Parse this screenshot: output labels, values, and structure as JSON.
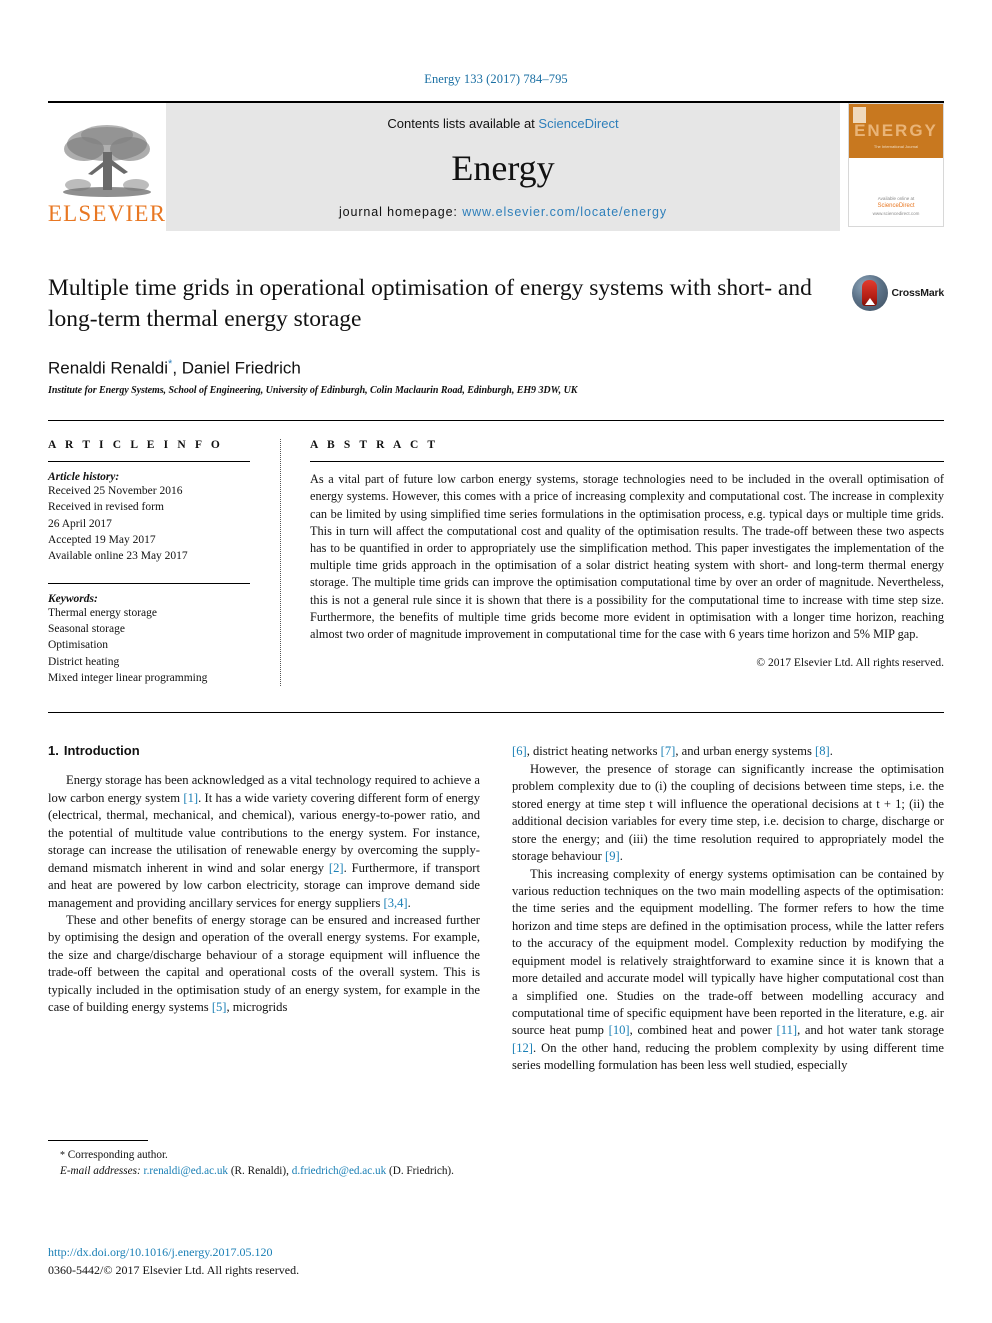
{
  "running_head": "Energy 133 (2017) 784–795",
  "banner": {
    "publisher_name": "ELSEVIER",
    "contents_prefix": "Contents lists available at ",
    "contents_link": "ScienceDirect",
    "journal_title": "Energy",
    "homepage_prefix": "journal homepage: ",
    "homepage_url": "www.elsevier.com/locate/energy",
    "cover_title": "ENERGY",
    "cover_subtitle": "The International Journal",
    "cover_footer_prefix": "Available online at",
    "cover_footer_brand": "ScienceDirect",
    "cover_footer_url": "www.sciencedirect.com"
  },
  "article": {
    "title": "Multiple time grids in operational optimisation of energy systems with short- and long-term thermal energy storage",
    "authors": "Renaldi Renaldi",
    "author_marker": "*",
    "authors_rest": ", Daniel Friedrich",
    "affiliation": "Institute for Energy Systems, School of Engineering, University of Edinburgh, Colin Maclaurin Road, Edinburgh, EH9 3DW, UK",
    "crossmark_label": "CrossMark"
  },
  "info": {
    "heading": "A R T I C L E   I N F O",
    "history_label": "Article history:",
    "history": [
      "Received 25 November 2016",
      "Received in revised form",
      "26 April 2017",
      "Accepted 19 May 2017",
      "Available online 23 May 2017"
    ],
    "keywords_label": "Keywords:",
    "keywords": [
      "Thermal energy storage",
      "Seasonal storage",
      "Optimisation",
      "District heating",
      "Mixed integer linear programming"
    ]
  },
  "abstract": {
    "heading": "A B S T R A C T",
    "text": "As a vital part of future low carbon energy systems, storage technologies need to be included in the overall optimisation of energy systems. However, this comes with a price of increasing complexity and computational cost. The increase in complexity can be limited by using simplified time series formulations in the optimisation process, e.g. typical days or multiple time grids. This in turn will affect the computational cost and quality of the optimisation results. The trade-off between these two aspects has to be quantified in order to appropriately use the simplification method. This paper investigates the implementation of the multiple time grids approach in the optimisation of a solar district heating system with short- and long-term thermal energy storage. The multiple time grids can improve the optimisation computational time by over an order of magnitude. Nevertheless, this is not a general rule since it is shown that there is a possibility for the computational time to increase with time step size. Furthermore, the benefits of multiple time grids become more evident in optimisation with a longer time horizon, reaching almost two order of magnitude improvement in computational time for the case with 6 years time horizon and 5% MIP gap.",
    "copyright": "© 2017 Elsevier Ltd. All rights reserved."
  },
  "body": {
    "section_number": "1.",
    "section_title": "Introduction",
    "left_paragraphs": [
      "Energy storage has been acknowledged as a vital technology required to achieve a low carbon energy system [1]. It has a wide variety covering different form of energy (electrical, thermal, mechanical, and chemical), various energy-to-power ratio, and the potential of multitude value contributions to the energy system. For instance, storage can increase the utilisation of renewable energy by overcoming the supply-demand mismatch inherent in wind and solar energy [2]. Furthermore, if transport and heat are powered by low carbon electricity, storage can improve demand side management and providing ancillary services for energy suppliers [3,4].",
      "These and other benefits of energy storage can be ensured and increased further by optimising the design and operation of the overall energy systems. For example, the size and charge/discharge behaviour of a storage equipment will influence the trade-off between the capital and operational costs of the overall system. This is typically included in the optimisation study of an energy system, for example in the case of building energy systems [5], microgrids"
    ],
    "right_paragraphs": [
      "[6], district heating networks [7], and urban energy systems [8].",
      "However, the presence of storage can significantly increase the optimisation problem complexity due to (i) the coupling of decisions between time steps, i.e. the stored energy at time step t will influence the operational decisions at t + 1; (ii) the additional decision variables for every time step, i.e. decision to charge, discharge or store the energy; and (iii) the time resolution required to appropriately model the storage behaviour [9].",
      "This increasing complexity of energy systems optimisation can be contained by various reduction techniques on the two main modelling aspects of the optimisation: the time series and the equipment modelling. The former refers to how the time horizon and time steps are defined in the optimisation process, while the latter refers to the accuracy of the equipment model. Complexity reduction by modifying the equipment model is relatively straightforward to examine since it is known that a more detailed and accurate model will typically have higher computational cost than a simplified one. Studies on the trade-off between modelling accuracy and computational time of specific equipment have been reported in the literature, e.g. air source heat pump [10], combined heat and power [11], and hot water tank storage [12]. On the other hand, reducing the problem complexity by using different time series modelling formulation has been less well studied, especially"
    ]
  },
  "footnotes": {
    "corresponding_marker": "*",
    "corresponding_text": "Corresponding author.",
    "email_label": "E-mail addresses:",
    "email_1": "r.renaldi@ed.ac.uk",
    "email_1_name": "(R. Renaldi),",
    "email_2": "d.friedrich@ed.ac.uk",
    "email_2_name": "(D. Friedrich).",
    "doi": "http://dx.doi.org/10.1016/j.energy.2017.05.120",
    "issn": "0360-5442/© 2017 Elsevier Ltd. All rights reserved."
  }
}
